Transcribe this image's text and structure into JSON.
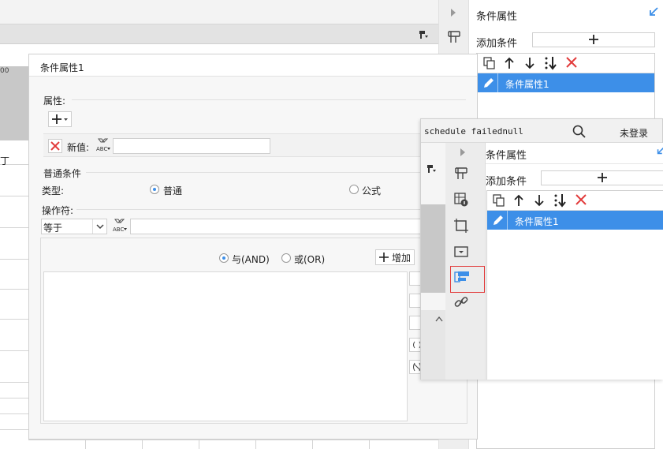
{
  "background": {
    "ruler_label": "00",
    "cut_text": "丁"
  },
  "main_panel": {
    "title": "条件属性",
    "add_condition_label": "添加条件",
    "list_item_label": "条件属性1"
  },
  "dialog": {
    "title": "条件属性1",
    "attribute_label": "属性:",
    "new_value_label": "新值:",
    "normal_condition_label": "普通条件",
    "type_label": "类型:",
    "type_option_normal": "普通",
    "type_option_formula": "公式",
    "operator_label": "操作符:",
    "operator_value": "等于",
    "and_label": "与(AND)",
    "or_label": "或(OR)",
    "add_button_label": "增加"
  },
  "popup": {
    "header_text": "schedule failednull",
    "login_label": "未登录",
    "panel_title": "条件属性",
    "add_condition_label": "添加条件",
    "list_item_label": "条件属性1"
  },
  "colors": {
    "accent": "#3d8fe8",
    "danger": "#e23b3b",
    "highlight_border": "#e23b3b"
  }
}
